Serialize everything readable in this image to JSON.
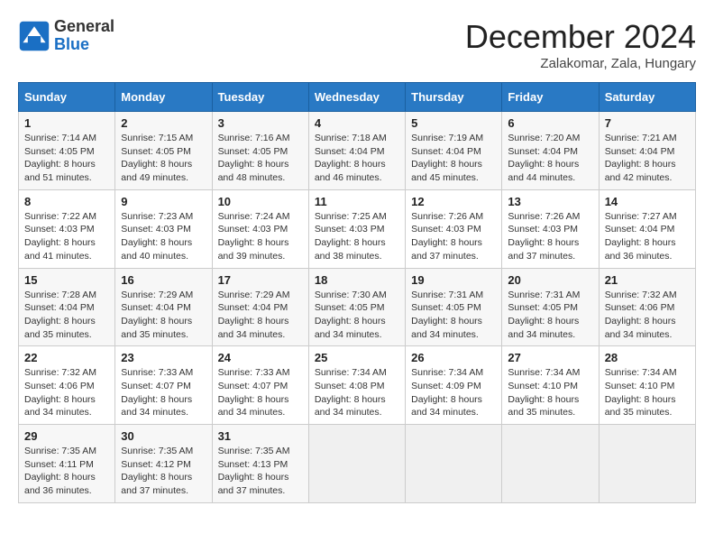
{
  "header": {
    "logo_general": "General",
    "logo_blue": "Blue",
    "month_title": "December 2024",
    "location": "Zalakomar, Zala, Hungary"
  },
  "weekdays": [
    "Sunday",
    "Monday",
    "Tuesday",
    "Wednesday",
    "Thursday",
    "Friday",
    "Saturday"
  ],
  "weeks": [
    [
      {
        "day": "1",
        "sunrise": "Sunrise: 7:14 AM",
        "sunset": "Sunset: 4:05 PM",
        "daylight": "Daylight: 8 hours and 51 minutes."
      },
      {
        "day": "2",
        "sunrise": "Sunrise: 7:15 AM",
        "sunset": "Sunset: 4:05 PM",
        "daylight": "Daylight: 8 hours and 49 minutes."
      },
      {
        "day": "3",
        "sunrise": "Sunrise: 7:16 AM",
        "sunset": "Sunset: 4:05 PM",
        "daylight": "Daylight: 8 hours and 48 minutes."
      },
      {
        "day": "4",
        "sunrise": "Sunrise: 7:18 AM",
        "sunset": "Sunset: 4:04 PM",
        "daylight": "Daylight: 8 hours and 46 minutes."
      },
      {
        "day": "5",
        "sunrise": "Sunrise: 7:19 AM",
        "sunset": "Sunset: 4:04 PM",
        "daylight": "Daylight: 8 hours and 45 minutes."
      },
      {
        "day": "6",
        "sunrise": "Sunrise: 7:20 AM",
        "sunset": "Sunset: 4:04 PM",
        "daylight": "Daylight: 8 hours and 44 minutes."
      },
      {
        "day": "7",
        "sunrise": "Sunrise: 7:21 AM",
        "sunset": "Sunset: 4:04 PM",
        "daylight": "Daylight: 8 hours and 42 minutes."
      }
    ],
    [
      {
        "day": "8",
        "sunrise": "Sunrise: 7:22 AM",
        "sunset": "Sunset: 4:03 PM",
        "daylight": "Daylight: 8 hours and 41 minutes."
      },
      {
        "day": "9",
        "sunrise": "Sunrise: 7:23 AM",
        "sunset": "Sunset: 4:03 PM",
        "daylight": "Daylight: 8 hours and 40 minutes."
      },
      {
        "day": "10",
        "sunrise": "Sunrise: 7:24 AM",
        "sunset": "Sunset: 4:03 PM",
        "daylight": "Daylight: 8 hours and 39 minutes."
      },
      {
        "day": "11",
        "sunrise": "Sunrise: 7:25 AM",
        "sunset": "Sunset: 4:03 PM",
        "daylight": "Daylight: 8 hours and 38 minutes."
      },
      {
        "day": "12",
        "sunrise": "Sunrise: 7:26 AM",
        "sunset": "Sunset: 4:03 PM",
        "daylight": "Daylight: 8 hours and 37 minutes."
      },
      {
        "day": "13",
        "sunrise": "Sunrise: 7:26 AM",
        "sunset": "Sunset: 4:03 PM",
        "daylight": "Daylight: 8 hours and 37 minutes."
      },
      {
        "day": "14",
        "sunrise": "Sunrise: 7:27 AM",
        "sunset": "Sunset: 4:04 PM",
        "daylight": "Daylight: 8 hours and 36 minutes."
      }
    ],
    [
      {
        "day": "15",
        "sunrise": "Sunrise: 7:28 AM",
        "sunset": "Sunset: 4:04 PM",
        "daylight": "Daylight: 8 hours and 35 minutes."
      },
      {
        "day": "16",
        "sunrise": "Sunrise: 7:29 AM",
        "sunset": "Sunset: 4:04 PM",
        "daylight": "Daylight: 8 hours and 35 minutes."
      },
      {
        "day": "17",
        "sunrise": "Sunrise: 7:29 AM",
        "sunset": "Sunset: 4:04 PM",
        "daylight": "Daylight: 8 hours and 34 minutes."
      },
      {
        "day": "18",
        "sunrise": "Sunrise: 7:30 AM",
        "sunset": "Sunset: 4:05 PM",
        "daylight": "Daylight: 8 hours and 34 minutes."
      },
      {
        "day": "19",
        "sunrise": "Sunrise: 7:31 AM",
        "sunset": "Sunset: 4:05 PM",
        "daylight": "Daylight: 8 hours and 34 minutes."
      },
      {
        "day": "20",
        "sunrise": "Sunrise: 7:31 AM",
        "sunset": "Sunset: 4:05 PM",
        "daylight": "Daylight: 8 hours and 34 minutes."
      },
      {
        "day": "21",
        "sunrise": "Sunrise: 7:32 AM",
        "sunset": "Sunset: 4:06 PM",
        "daylight": "Daylight: 8 hours and 34 minutes."
      }
    ],
    [
      {
        "day": "22",
        "sunrise": "Sunrise: 7:32 AM",
        "sunset": "Sunset: 4:06 PM",
        "daylight": "Daylight: 8 hours and 34 minutes."
      },
      {
        "day": "23",
        "sunrise": "Sunrise: 7:33 AM",
        "sunset": "Sunset: 4:07 PM",
        "daylight": "Daylight: 8 hours and 34 minutes."
      },
      {
        "day": "24",
        "sunrise": "Sunrise: 7:33 AM",
        "sunset": "Sunset: 4:07 PM",
        "daylight": "Daylight: 8 hours and 34 minutes."
      },
      {
        "day": "25",
        "sunrise": "Sunrise: 7:34 AM",
        "sunset": "Sunset: 4:08 PM",
        "daylight": "Daylight: 8 hours and 34 minutes."
      },
      {
        "day": "26",
        "sunrise": "Sunrise: 7:34 AM",
        "sunset": "Sunset: 4:09 PM",
        "daylight": "Daylight: 8 hours and 34 minutes."
      },
      {
        "day": "27",
        "sunrise": "Sunrise: 7:34 AM",
        "sunset": "Sunset: 4:10 PM",
        "daylight": "Daylight: 8 hours and 35 minutes."
      },
      {
        "day": "28",
        "sunrise": "Sunrise: 7:34 AM",
        "sunset": "Sunset: 4:10 PM",
        "daylight": "Daylight: 8 hours and 35 minutes."
      }
    ],
    [
      {
        "day": "29",
        "sunrise": "Sunrise: 7:35 AM",
        "sunset": "Sunset: 4:11 PM",
        "daylight": "Daylight: 8 hours and 36 minutes."
      },
      {
        "day": "30",
        "sunrise": "Sunrise: 7:35 AM",
        "sunset": "Sunset: 4:12 PM",
        "daylight": "Daylight: 8 hours and 37 minutes."
      },
      {
        "day": "31",
        "sunrise": "Sunrise: 7:35 AM",
        "sunset": "Sunset: 4:13 PM",
        "daylight": "Daylight: 8 hours and 37 minutes."
      },
      null,
      null,
      null,
      null
    ]
  ]
}
